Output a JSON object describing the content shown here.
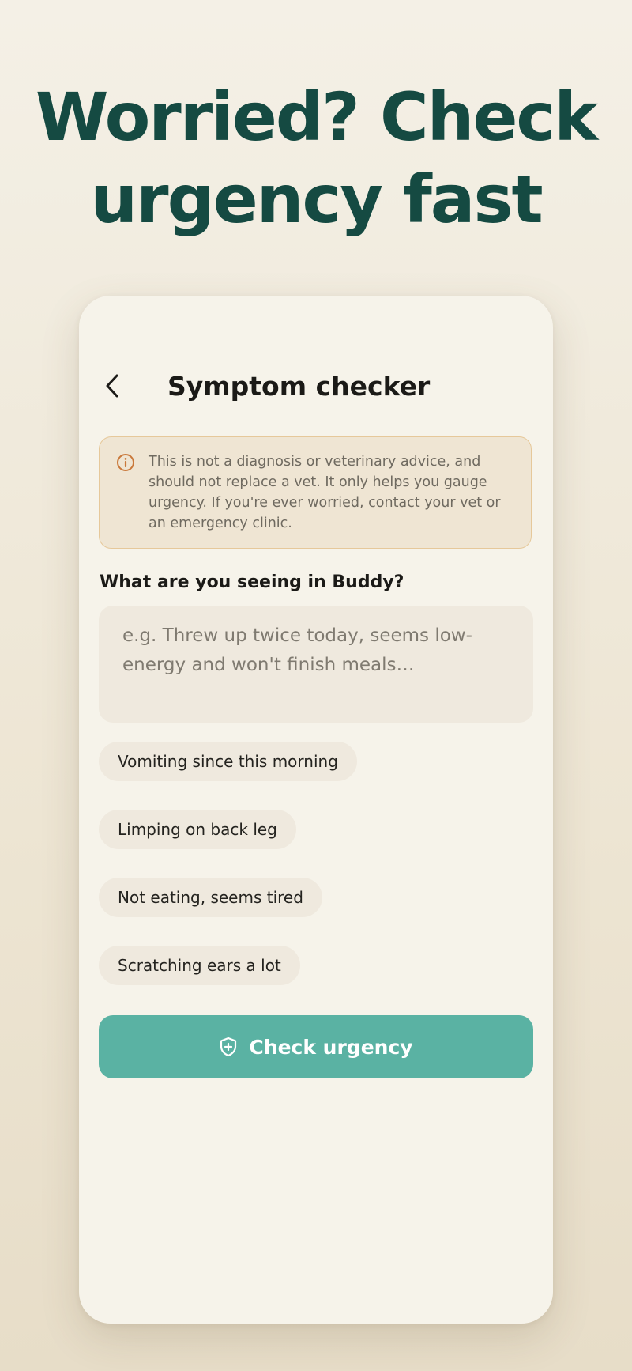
{
  "headline": {
    "line1": "Worried? Check",
    "line2": "urgency fast"
  },
  "screen": {
    "title": "Symptom checker",
    "back_icon": "chevron-left-icon"
  },
  "disclaimer": {
    "icon": "info-circle-icon",
    "text": "This is not a diagnosis or veterinary advice, and should not replace a vet. It only helps you gauge urgency. If you're ever worried, contact your vet or an emergency clinic."
  },
  "symptoms": {
    "label": "What are you seeing in Buddy?",
    "value": "",
    "placeholder": "e.g. Threw up twice today, seems low-energy and won't finish meals…"
  },
  "suggestions": [
    {
      "label": "Vomiting since this morning"
    },
    {
      "label": "Limping on back leg"
    },
    {
      "label": "Not eating, seems tired"
    },
    {
      "label": "Scratching ears a lot"
    }
  ],
  "cta": {
    "label": "Check urgency",
    "icon": "shield-plus-icon"
  },
  "colors": {
    "headline": "#154a42",
    "accent": "#5ab2a3",
    "card_background": "#f6f3ea",
    "disclaimer_background": "#efe5d3",
    "disclaimer_border": "#e6c89a",
    "info_icon": "#c9783a",
    "chip_background": "#efe9de"
  }
}
